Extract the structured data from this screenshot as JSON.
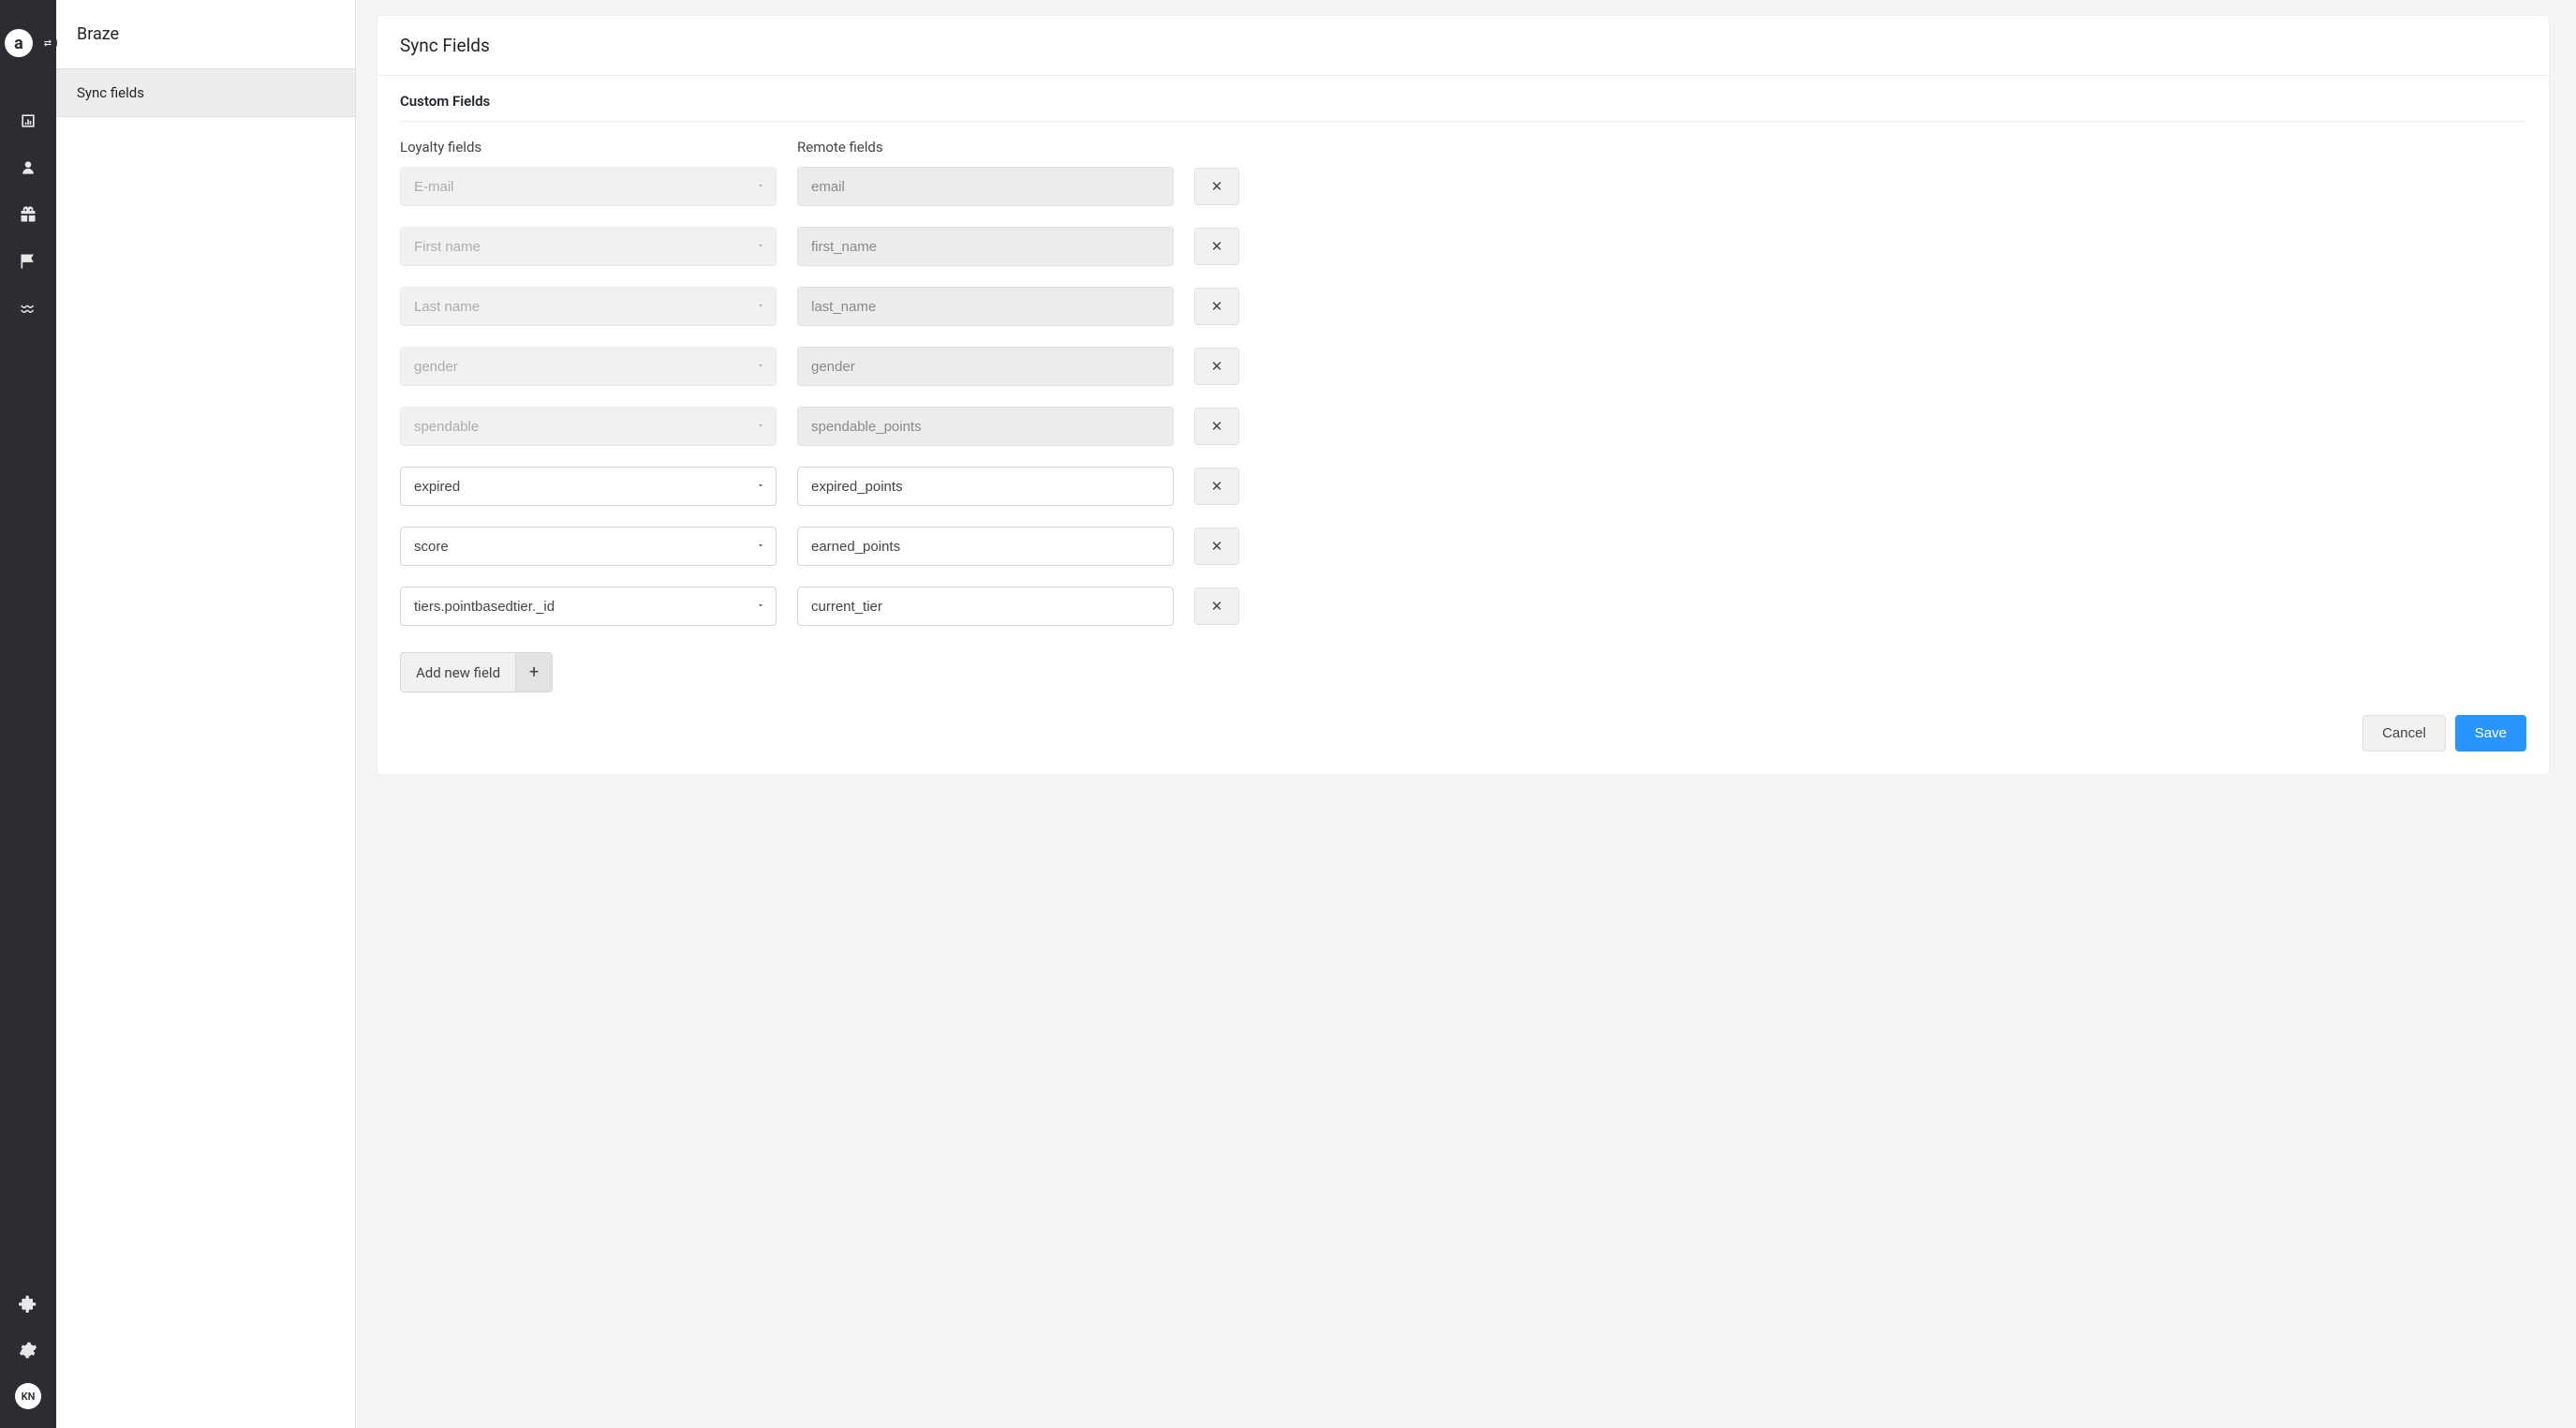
{
  "rail": {
    "logo_letter": "a",
    "avatar_initials": "KN"
  },
  "sidebar": {
    "title": "Braze",
    "nav_item": "Sync fields"
  },
  "main": {
    "card_title": "Sync Fields",
    "section_title": "Custom Fields",
    "col_a_label": "Loyalty fields",
    "col_b_label": "Remote fields",
    "rows": [
      {
        "loyalty": "E-mail",
        "remote": "email",
        "locked": true
      },
      {
        "loyalty": "First name",
        "remote": "first_name",
        "locked": true
      },
      {
        "loyalty": "Last name",
        "remote": "last_name",
        "locked": true
      },
      {
        "loyalty": "gender",
        "remote": "gender",
        "locked": true
      },
      {
        "loyalty": "spendable",
        "remote": "spendable_points",
        "locked": true
      },
      {
        "loyalty": "expired",
        "remote": "expired_points",
        "locked": false
      },
      {
        "loyalty": "score",
        "remote": "earned_points",
        "locked": false
      },
      {
        "loyalty": "tiers.pointbasedtier._id",
        "remote": "current_tier",
        "locked": false
      }
    ],
    "add_label": "Add new field",
    "cancel_label": "Cancel",
    "save_label": "Save"
  }
}
